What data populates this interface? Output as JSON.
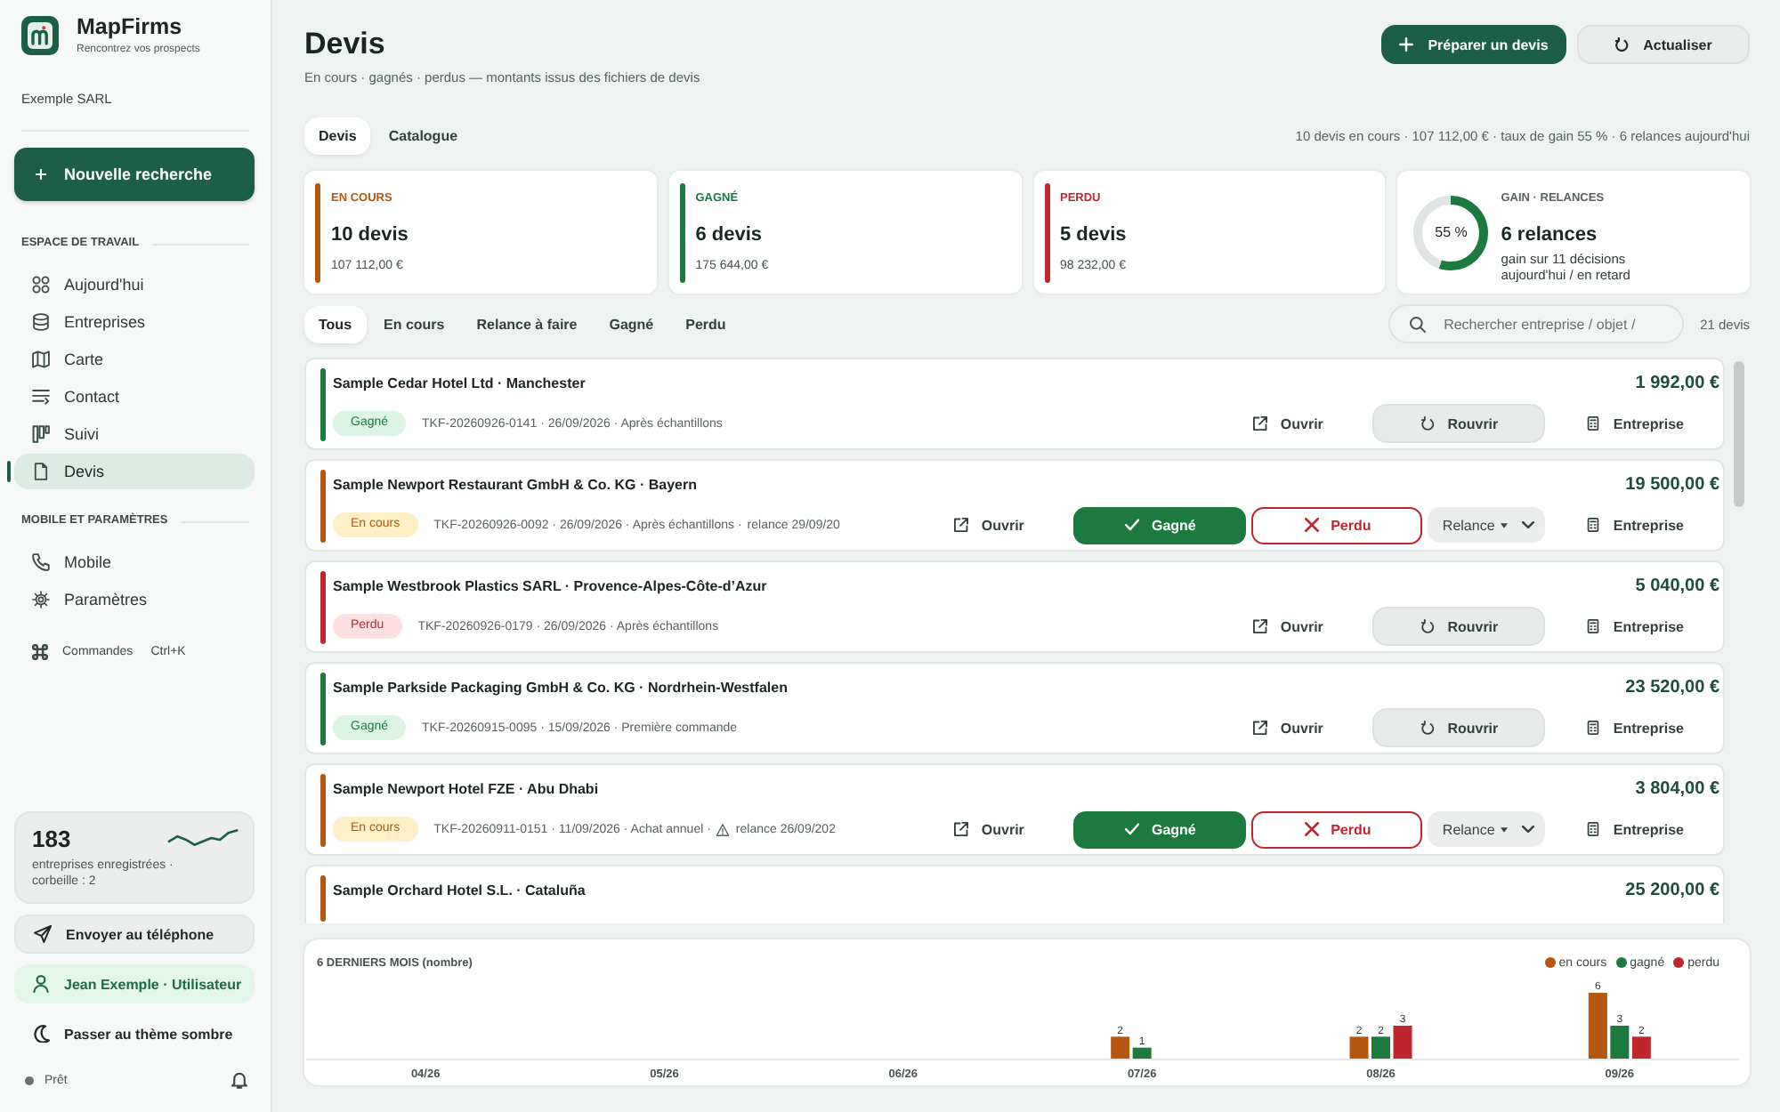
{
  "sidebar": {
    "brand": {
      "name": "MapFirms",
      "tagline": "Rencontrez vos prospects"
    },
    "account": "Exemple SARL",
    "new_search": {
      "label": "Nouvelle recherche"
    },
    "sections": [
      {
        "title": "ESPACE DE TRAVAIL",
        "items": [
          {
            "label": "Aujourd'hui",
            "selected": false
          },
          {
            "label": "Entreprises",
            "selected": false
          },
          {
            "label": "Carte",
            "selected": false
          },
          {
            "label": "Contact",
            "selected": false
          },
          {
            "label": "Suivi",
            "selected": false
          },
          {
            "label": "Devis",
            "selected": true
          }
        ]
      },
      {
        "title": "MOBILE ET PARAMÈTRES",
        "items": [
          {
            "label": "Mobile",
            "selected": false
          },
          {
            "label": "Paramètres",
            "selected": false
          }
        ]
      }
    ],
    "commands": {
      "label": "Commandes",
      "shortcut": "Ctrl+K"
    },
    "stats": {
      "count": "183",
      "caption": "entreprises enregistrées · corbeille : 2"
    },
    "actions": [
      {
        "kind": "send",
        "label": "Envoyer au téléphone"
      },
      {
        "kind": "user",
        "label": "Jean Exemple · Utilisateur"
      },
      {
        "kind": "theme",
        "label": "Passer au thème sombre"
      }
    ],
    "status": "Prêt"
  },
  "header": {
    "title": "Devis",
    "subtitle": "En cours · gagnés · perdus — montants issus des fichiers de devis",
    "buttons": [
      {
        "kind": "primary",
        "label": "Préparer un devis"
      },
      {
        "kind": "refresh",
        "label": "Actualiser"
      }
    ]
  },
  "view_tabs": [
    {
      "label": "Devis",
      "selected": true
    },
    {
      "label": "Catalogue",
      "selected": false
    }
  ],
  "summary": "10 devis en cours · 107 112,00 € · taux de gain 55 % · 6 relances aujourd'hui",
  "stats": [
    {
      "kind": "status",
      "color": "#b5570f",
      "label": "EN COURS",
      "value": "10 devis",
      "amount": "107 112,00 €"
    },
    {
      "kind": "status",
      "color": "#1c7a3f",
      "label": "GAGNÉ",
      "value": "6 devis",
      "amount": "175 644,00 €"
    },
    {
      "kind": "status",
      "color": "#c0262d",
      "label": "PERDU",
      "value": "5 devis",
      "amount": "98 232,00 €"
    },
    {
      "kind": "gauge",
      "label": "GAIN · RELANCES",
      "level": 0.55,
      "reading": "55 %",
      "value": "6 relances",
      "notes": [
        "gain sur 11 décisions",
        "aujourd'hui / en retard"
      ]
    }
  ],
  "filters": [
    {
      "label": "Tous",
      "selected": true
    },
    {
      "label": "En cours",
      "selected": false
    },
    {
      "label": "Relance à faire",
      "selected": false
    },
    {
      "label": "Gagné",
      "selected": false
    },
    {
      "label": "Perdu",
      "selected": false
    }
  ],
  "search": {
    "placeholder": "Rechercher entreprise / objet /"
  },
  "count": "21 devis",
  "quotes": [
    {
      "title": "Sample Cedar Hotel Ltd · Manchester",
      "amount": "1 992,00 €",
      "color": "#1c7a3f",
      "badge": {
        "label": "Gagné",
        "color": "#dcf5e4"
      },
      "meta": "TKF-20260926-0141 · 26/09/2026 · Après échantillons",
      "actions": [
        {
          "kind": "open",
          "label": "Ouvrir"
        },
        {
          "kind": "reopen",
          "label": "Rouvrir"
        },
        {
          "kind": "company",
          "label": "Entreprise"
        }
      ]
    },
    {
      "title": "Sample Newport Restaurant GmbH & Co. KG · Bayern",
      "amount": "19 500,00 €",
      "color": "#b5570f",
      "badge": {
        "label": "En cours",
        "color": "#fdefc6"
      },
      "meta": "TKF-20260926-0092 · 26/09/2026 · Après échantillons ·",
      "followup": {
        "text": "relance 29/09/20",
        "overdue": false
      },
      "actions": [
        {
          "kind": "open",
          "label": "Ouvrir"
        },
        {
          "kind": "win",
          "label": "Gagné"
        },
        {
          "kind": "lose",
          "label": "Perdu"
        },
        {
          "kind": "followup",
          "label": "Relance"
        },
        {
          "kind": "company",
          "label": "Entreprise"
        }
      ]
    },
    {
      "title": "Sample Westbrook Plastics SARL · Provence-Alpes-Côte-d’Azur",
      "amount": "5 040,00 €",
      "color": "#c0262d",
      "badge": {
        "label": "Perdu",
        "color": "#fde0e2"
      },
      "meta": "TKF-20260926-0179 · 26/09/2026 · Après échantillons",
      "actions": [
        {
          "kind": "open",
          "label": "Ouvrir"
        },
        {
          "kind": "reopen",
          "label": "Rouvrir"
        },
        {
          "kind": "company",
          "label": "Entreprise"
        }
      ]
    },
    {
      "title": "Sample Parkside Packaging GmbH & Co. KG · Nordrhein-Westfalen",
      "amount": "23 520,00 €",
      "color": "#1c7a3f",
      "badge": {
        "label": "Gagné",
        "color": "#dcf5e4"
      },
      "meta": "TKF-20260915-0095 · 15/09/2026 · Première commande",
      "actions": [
        {
          "kind": "open",
          "label": "Ouvrir"
        },
        {
          "kind": "reopen",
          "label": "Rouvrir"
        },
        {
          "kind": "company",
          "label": "Entreprise"
        }
      ]
    },
    {
      "title": "Sample Newport Hotel FZE · Abu Dhabi",
      "amount": "3 804,00 €",
      "color": "#b5570f",
      "badge": {
        "label": "En cours",
        "color": "#fdefc6"
      },
      "meta": "TKF-20260911-0151 · 11/09/2026 · Achat annuel ·",
      "followup": {
        "text": "relance 26/09/202",
        "overdue": true
      },
      "actions": [
        {
          "kind": "open",
          "label": "Ouvrir"
        },
        {
          "kind": "win",
          "label": "Gagné"
        },
        {
          "kind": "lose",
          "label": "Perdu"
        },
        {
          "kind": "followup",
          "label": "Relance"
        },
        {
          "kind": "company",
          "label": "Entreprise"
        }
      ]
    },
    {
      "title": "Sample Orchard Hotel S.L. · Cataluña",
      "amount": "25 200,00 €",
      "color": "#b5570f"
    }
  ],
  "chart": {
    "chart_data": {
      "type": "bar",
      "title": "6 DERNIERS MOIS (nombre)",
      "legend": "top right",
      "categories": [
        "04/26",
        "05/26",
        "06/26",
        "07/26",
        "08/26",
        "09/26"
      ],
      "series": [
        {
          "name": "en cours",
          "color": "#b5570f",
          "values": [
            0,
            0,
            0,
            2,
            2,
            6
          ],
          "value_labels": [
            null,
            null,
            null,
            "2",
            "2",
            "6"
          ]
        },
        {
          "name": "gagné",
          "color": "#1c7a3f",
          "values": [
            0,
            0,
            0,
            1,
            2,
            3
          ],
          "value_labels": [
            null,
            null,
            null,
            "1",
            "2",
            "3"
          ]
        },
        {
          "name": "perdu",
          "color": "#c0262d",
          "values": [
            0,
            0,
            0,
            0,
            3,
            2
          ],
          "value_labels": [
            null,
            null,
            null,
            null,
            "3",
            "2"
          ]
        }
      ]
    }
  }
}
